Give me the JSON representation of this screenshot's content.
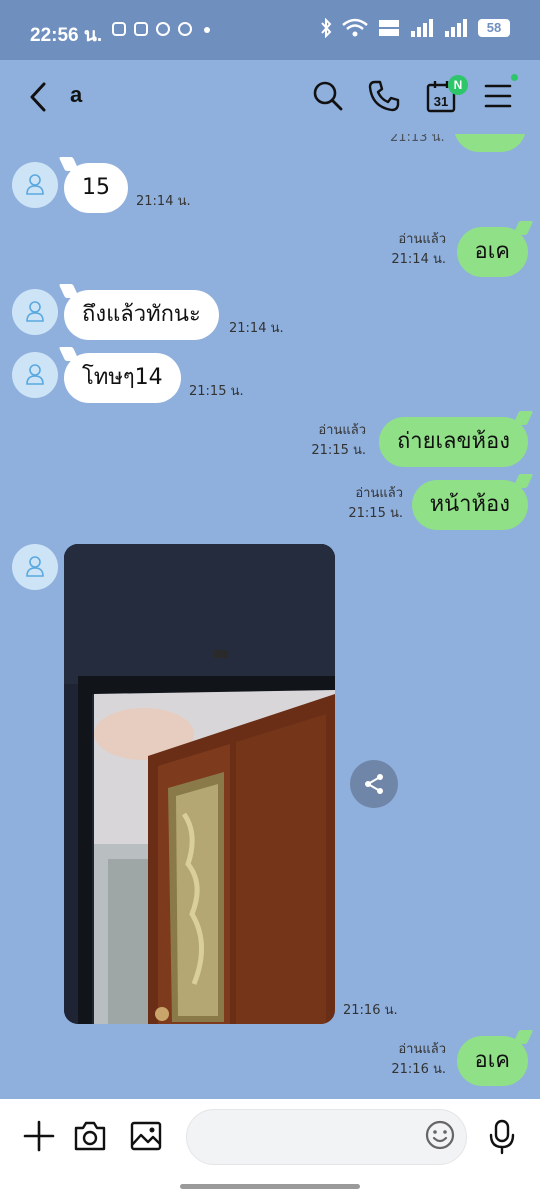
{
  "status_bar": {
    "time": "22:56 น.",
    "battery": "58"
  },
  "header": {
    "chat_name": "a",
    "calendar_day": "31",
    "calendar_badge": "N"
  },
  "messages": [
    {
      "side": "in",
      "text": "15",
      "time": "21:14 น."
    },
    {
      "side": "out",
      "text": "อเค",
      "read": "อ่านแล้ว",
      "time": "21:14 น."
    },
    {
      "side": "in",
      "text": "ถึงแล้วทักนะ",
      "time": "21:14 น."
    },
    {
      "side": "in",
      "text": "โทษๆ14",
      "time": "21:15 น."
    },
    {
      "side": "out",
      "text": "ถ่ายเลขห้อง",
      "read": "อ่านแล้ว",
      "time": "21:15 น."
    },
    {
      "side": "out",
      "text": "หน้าห้อง",
      "read": "อ่านแล้ว",
      "time": "21:15 น."
    },
    {
      "side": "in",
      "type": "image",
      "time": "21:16 น."
    },
    {
      "side": "out",
      "text": "อเค",
      "read": "อ่านแล้ว",
      "time": "21:16 น."
    }
  ],
  "partial_top_time": "21:13 น.",
  "input": {
    "placeholder": ""
  },
  "colors": {
    "background": "#8fb0dd",
    "status_bar": "#6f8fbf",
    "incoming_bubble": "#ffffff",
    "outgoing_bubble": "#8fe086",
    "badge": "#2dc66a"
  },
  "icons": [
    "back-icon",
    "search-icon",
    "phone-icon",
    "calendar-icon",
    "menu-icon",
    "plus-icon",
    "camera-icon",
    "gallery-icon",
    "emoji-icon",
    "mic-icon",
    "share-icon"
  ]
}
